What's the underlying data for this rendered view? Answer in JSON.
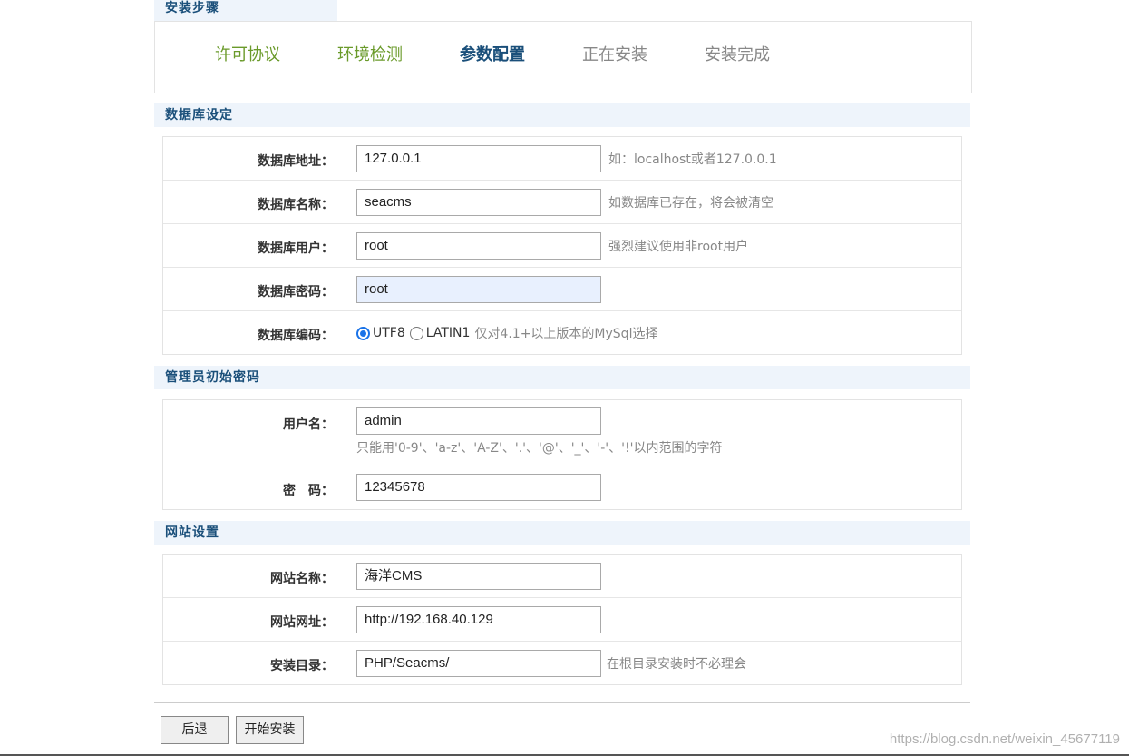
{
  "steps": {
    "title": "安装步骤",
    "items": [
      {
        "label": "许可协议",
        "state": "done"
      },
      {
        "label": "环境检测",
        "state": "done"
      },
      {
        "label": "参数配置",
        "state": "active"
      },
      {
        "label": "正在安装",
        "state": "todo"
      },
      {
        "label": "安装完成",
        "state": "todo"
      }
    ]
  },
  "db": {
    "section_title": "数据库设定",
    "host_label": "数据库地址：",
    "host_value": "127.0.0.1",
    "host_hint": "如：localhost或者127.0.0.1",
    "name_label": "数据库名称：",
    "name_value": "seacms",
    "name_hint": "如数据库已存在，将会被清空",
    "user_label": "数据库用户：",
    "user_value": "root",
    "user_hint": "强烈建议使用非root用户",
    "pass_label": "数据库密码：",
    "pass_value": "root",
    "charset_label": "数据库编码：",
    "charset_option_1": "UTF8",
    "charset_option_2": "LATIN1",
    "charset_hint": "仅对4.1+以上版本的MySql选择"
  },
  "admin": {
    "section_title": "管理员初始密码",
    "username_label": "用户名：",
    "username_value": "admin",
    "username_hint": "只能用'0-9'、'a-z'、'A-Z'、'.'、'@'、'_'、'-'、'!'以内范围的字符",
    "password_label": "密　码：",
    "password_value": "12345678"
  },
  "site": {
    "section_title": "网站设置",
    "name_label": "网站名称：",
    "name_value": "海洋CMS",
    "url_label": "网站网址：",
    "url_value": "http://192.168.40.129",
    "dir_label": "安装目录：",
    "dir_value": "PHP/Seacms/",
    "dir_hint": "在根目录安装时不必理会"
  },
  "buttons": {
    "back": "后退",
    "install": "开始安装"
  },
  "watermark": "https://blog.csdn.net/weixin_45677119"
}
